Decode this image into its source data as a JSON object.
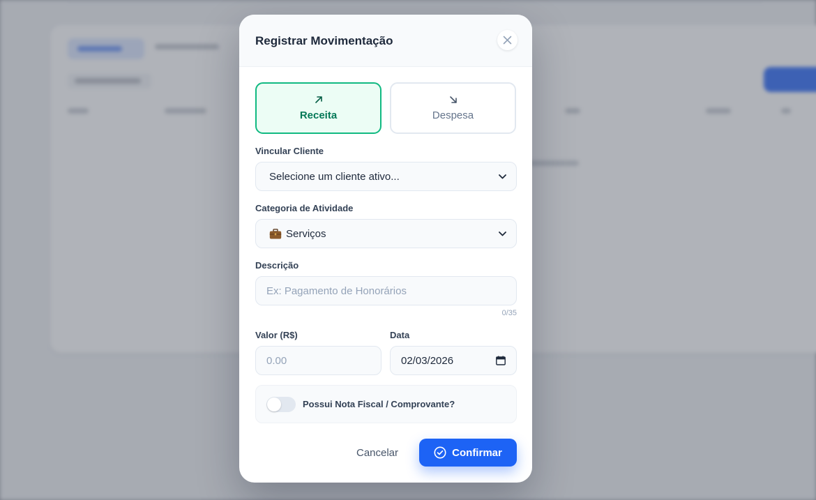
{
  "modal": {
    "title": "Registrar Movimentação",
    "close_icon": "close-icon"
  },
  "type_toggle": {
    "income": {
      "label": "Receita",
      "icon": "arrow-up-right-icon",
      "selected": true,
      "color": "#10b981"
    },
    "expense": {
      "label": "Despesa",
      "icon": "arrow-down-right-icon",
      "selected": false
    }
  },
  "client": {
    "label": "Vincular Cliente",
    "value": "Selecione um cliente ativo..."
  },
  "category": {
    "label": "Categoria de Atividade",
    "icon": "briefcase-icon",
    "value": "Serviços"
  },
  "description": {
    "label": "Descrição",
    "placeholder": "Ex: Pagamento de Honorários",
    "counter": "0/35"
  },
  "amount": {
    "label": "Valor (R$)",
    "placeholder": "0.00"
  },
  "date": {
    "label": "Data",
    "value": "02/03/2026",
    "icon": "calendar-icon"
  },
  "invoice": {
    "label": "Possui Nota Fiscal / Comprovante?",
    "enabled": false
  },
  "actions": {
    "cancel_label": "Cancelar",
    "confirm_label": "Confirmar",
    "confirm_icon": "check-circle-icon",
    "confirm_color": "#1d63f5"
  }
}
